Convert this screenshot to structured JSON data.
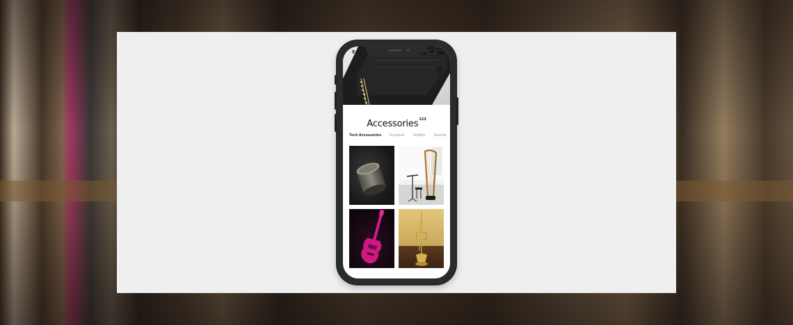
{
  "status_bar": {
    "time": "9:41"
  },
  "header": {
    "back_icon": "chevron-left-icon",
    "filter_icon": "filter-funnel-icon"
  },
  "page": {
    "title": "Accessories",
    "count": "123"
  },
  "tabs": [
    {
      "label": "Tech Accessories",
      "active": true
    },
    {
      "label": "Eyewear",
      "active": false
    },
    {
      "label": "Wallets",
      "active": false
    },
    {
      "label": "Jewelle",
      "active": false
    }
  ],
  "products": [
    {
      "image": "metal-tin-on-dark-background"
    },
    {
      "image": "harp-and-music-stand-in-room"
    },
    {
      "image": "pink-electric-guitar-on-black"
    },
    {
      "image": "brass-trumpet-on-wooden-table"
    }
  ],
  "colors": {
    "card_background": "#efefef",
    "phone_frame": "#2a2b2b",
    "screen_background": "#ffffff",
    "active_tab": "#111111",
    "inactive_tab": "#999999"
  }
}
